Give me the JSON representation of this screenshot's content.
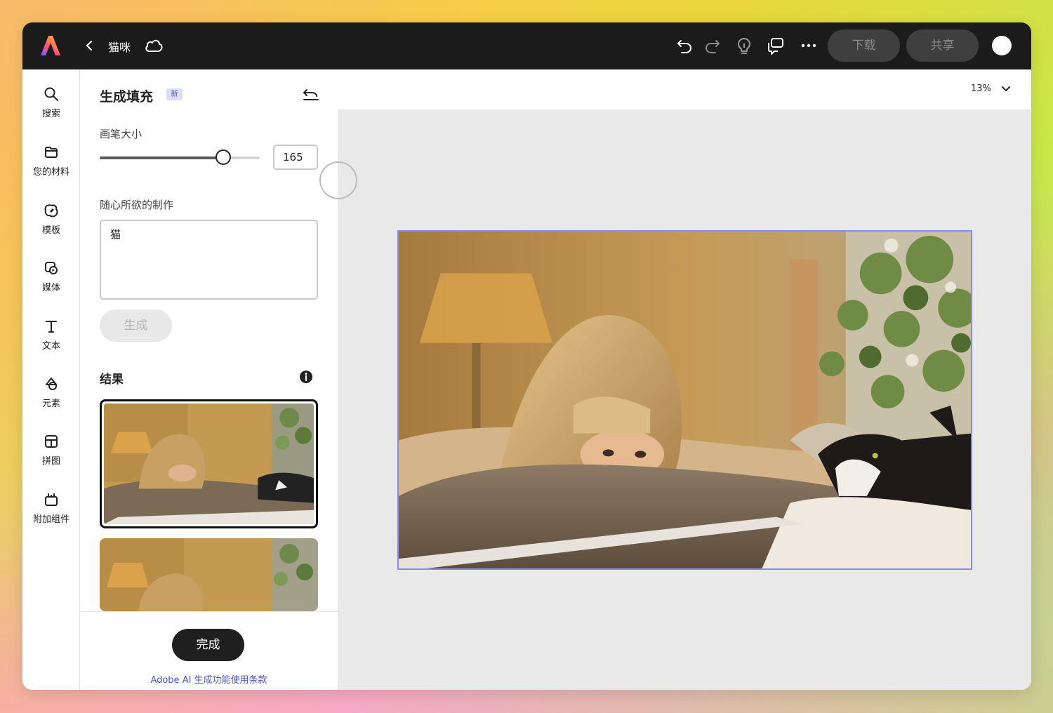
{
  "app": {
    "document_title": "猫咪"
  },
  "topbar": {
    "download_label": "下载",
    "share_label": "共享",
    "icons": [
      "adobe-express-logo",
      "chevron-left-icon",
      "cloud-icon",
      "undo-icon",
      "redo-icon",
      "lightbulb-icon",
      "comment-icon",
      "more-icon"
    ]
  },
  "leftnav": {
    "items": [
      {
        "label": "搜索",
        "icon": "search-icon"
      },
      {
        "label": "您的材料",
        "icon": "folder-icon"
      },
      {
        "label": "模板",
        "icon": "templates-icon"
      },
      {
        "label": "媒体",
        "icon": "media-icon"
      },
      {
        "label": "文本",
        "icon": "text-icon"
      },
      {
        "label": "元素",
        "icon": "elements-icon"
      },
      {
        "label": "拼图",
        "icon": "grid-icon"
      },
      {
        "label": "附加组件",
        "icon": "add-ons-icon"
      }
    ]
  },
  "panel": {
    "title": "生成填充",
    "badge": "新",
    "brush_size_label": "画笔大小",
    "brush_size_value": "165",
    "brush_size_fraction": 0.77,
    "prompt_label": "随心所欲的制作",
    "prompt_value": "猫",
    "generate_label": "生成",
    "results_title": "结果",
    "done_label": "完成",
    "terms_link": "Adobe AI 生成功能使用条款"
  },
  "canvas": {
    "zoom": "13%"
  },
  "colors": {
    "accent": "#8a8af0",
    "link": "#4a55c8",
    "topbar": "#1b1b1b"
  }
}
